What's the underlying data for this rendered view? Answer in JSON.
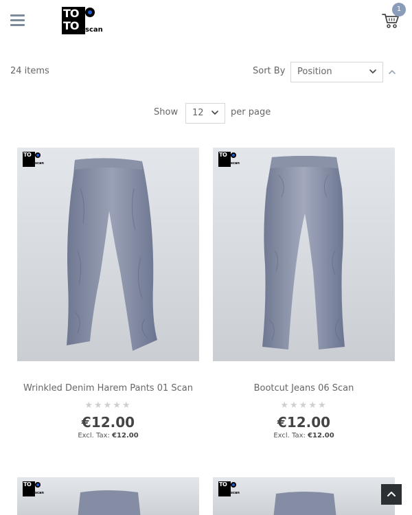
{
  "header": {
    "menu_icon": "hamburger-menu-icon",
    "logo": {
      "line1": "TO",
      "line2": "TO",
      "suffix": "scan"
    },
    "cart_icon": "shopping-cart-icon",
    "cart_count": "1"
  },
  "toolbar": {
    "items_count": "24 items",
    "sort_label": "Sort By",
    "sort_value": "Position",
    "sort_direction_icon": "chevron-up-icon",
    "show_label": "Show",
    "limit_value": "12",
    "per_page_label": "per page"
  },
  "products": [
    {
      "name": "Wrinkled Denim Harem Pants 01 Scan",
      "stars": "★★★★★",
      "rating": 0,
      "price": "€12.00",
      "tax_label": "Excl. Tax:",
      "tax_value": "€12.00"
    },
    {
      "name": "Bootcut Jeans 06 Scan",
      "stars": "★★★★★",
      "rating": 0,
      "price": "€12.00",
      "tax_label": "Excl. Tax:",
      "tax_value": "€12.00"
    }
  ],
  "back_to_top_icon": "chevron-up-icon"
}
